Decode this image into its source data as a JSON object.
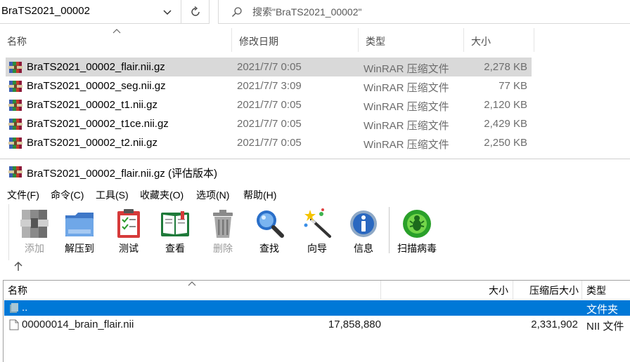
{
  "explorer": {
    "path": "BraTS2021_00002",
    "search_placeholder": "搜索\"BraTS2021_00002\"",
    "columns": {
      "name": "名称",
      "date": "修改日期",
      "type": "类型",
      "size": "大小"
    },
    "files": [
      {
        "name": "BraTS2021_00002_flair.nii.gz",
        "date": "2021/7/7 0:05",
        "type": "WinRAR 压缩文件",
        "size": "2,278 KB",
        "selected": true
      },
      {
        "name": "BraTS2021_00002_seg.nii.gz",
        "date": "2021/7/7 3:09",
        "type": "WinRAR 压缩文件",
        "size": "77 KB",
        "selected": false
      },
      {
        "name": "BraTS2021_00002_t1.nii.gz",
        "date": "2021/7/7 0:05",
        "type": "WinRAR 压缩文件",
        "size": "2,120 KB",
        "selected": false
      },
      {
        "name": "BraTS2021_00002_t1ce.nii.gz",
        "date": "2021/7/7 0:05",
        "type": "WinRAR 压缩文件",
        "size": "2,429 KB",
        "selected": false
      },
      {
        "name": "BraTS2021_00002_t2.nii.gz",
        "date": "2021/7/7 0:05",
        "type": "WinRAR 压缩文件",
        "size": "2,250 KB",
        "selected": false
      }
    ]
  },
  "winrar": {
    "title": "BraTS2021_00002_flair.nii.gz (评估版本)",
    "menu": [
      "文件(F)",
      "命令(C)",
      "工具(S)",
      "收藏夹(O)",
      "选项(N)",
      "帮助(H)"
    ],
    "toolbar": {
      "add": "添加",
      "extract": "解压到",
      "test": "测试",
      "view": "查看",
      "delete": "删除",
      "find": "查找",
      "wizard": "向导",
      "info": "信息",
      "scan": "扫描病毒"
    },
    "columns": {
      "name": "名称",
      "size": "大小",
      "packed": "压缩后大小",
      "type": "类型"
    },
    "rows": [
      {
        "name": "..",
        "size": "",
        "packed": "",
        "type": "文件夹",
        "selected": true
      },
      {
        "name": "00000014_brain_flair.nii",
        "size": "17,858,880",
        "packed": "2,331,902",
        "type": "NII 文件",
        "selected": false
      }
    ]
  },
  "icons": {
    "archive": "winrar-archive-icon",
    "folder_up": "folder-up-icon",
    "file": "file-icon"
  },
  "colors": {
    "selection_blue": "#0078d7",
    "explorer_selection": "#d9d9d9"
  }
}
